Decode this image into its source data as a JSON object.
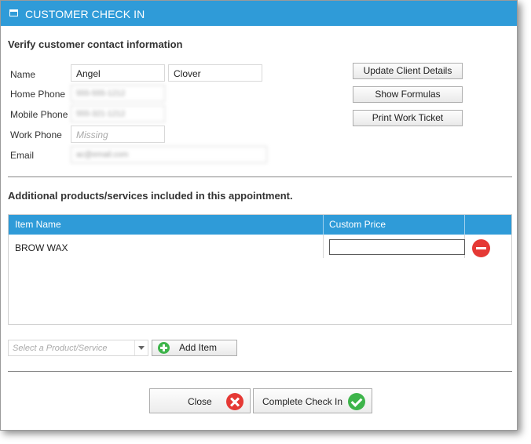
{
  "window": {
    "title": "CUSTOMER CHECK IN",
    "accent_color": "#2f9bd8"
  },
  "contact": {
    "heading": "Verify customer contact information",
    "labels": {
      "name": "Name",
      "home_phone": "Home Phone",
      "mobile_phone": "Mobile Phone",
      "work_phone": "Work Phone",
      "email": "Email"
    },
    "first_name": "Angel",
    "last_name": "Clover",
    "home_phone": "555-555-1212",
    "mobile_phone": "555-321-1212",
    "work_phone_placeholder": "Missing",
    "email": "ac@email.com"
  },
  "actions": {
    "update_client_details": "Update Client Details",
    "show_formulas": "Show Formulas",
    "print_work_ticket": "Print Work Ticket"
  },
  "products": {
    "heading": "Additional products/services included in this appointment.",
    "columns": [
      "Item Name",
      "Custom Price"
    ],
    "rows": [
      {
        "item_name": "BROW WAX",
        "custom_price": ""
      }
    ],
    "select_placeholder": "Select a Product/Service",
    "add_item_label": "Add Item"
  },
  "footer": {
    "close_label": "Close",
    "complete_label": "Complete Check In"
  },
  "icons": {
    "title": "window-icon",
    "remove": "remove-circle-icon",
    "add": "add-circle-icon",
    "close": "close-circle-icon",
    "check": "check-circle-icon"
  }
}
